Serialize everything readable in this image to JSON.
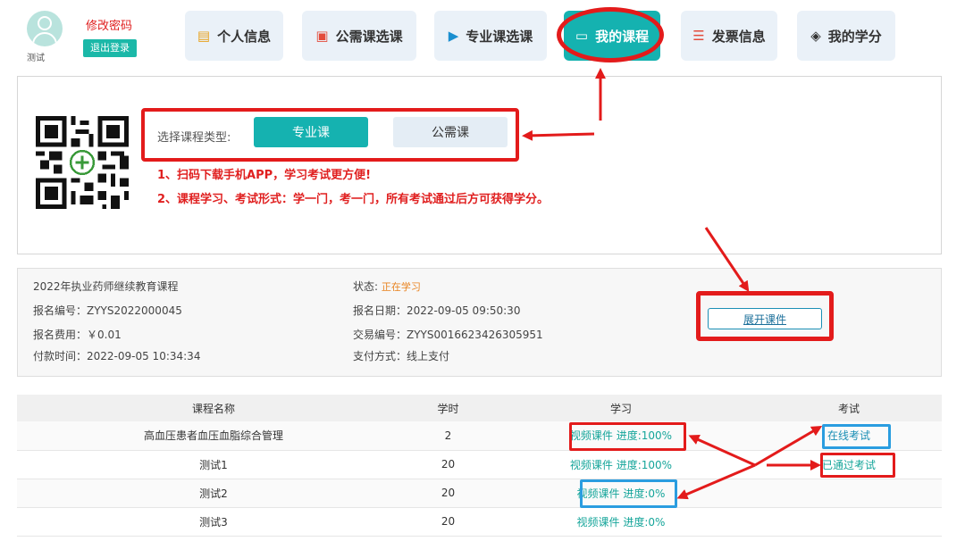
{
  "user": {
    "name": "测试",
    "change_password": "修改密码",
    "logout": "退出登录"
  },
  "nav": [
    {
      "label": "个人信息",
      "icon": "id-card-icon"
    },
    {
      "label": "公需课选课",
      "icon": "document-icon"
    },
    {
      "label": "专业课选课",
      "icon": "video-icon"
    },
    {
      "label": "我的课程",
      "icon": "chat-icon",
      "active": true
    },
    {
      "label": "发票信息",
      "icon": "invoice-icon"
    },
    {
      "label": "我的学分",
      "icon": "graduation-cap-icon"
    }
  ],
  "course_type": {
    "label": "选择课程类型:",
    "options": [
      "专业课",
      "公需课"
    ],
    "selected": "专业课"
  },
  "tips": [
    "1、扫码下载手机APP，学习考试更方便!",
    "2、课程学习、考试形式：学一门，考一门，所有考试通过后方可获得学分。"
  ],
  "enrollment": {
    "title": "2022年执业药师继续教育课程",
    "reg_no": "报名编号：ZYYS2022000045",
    "fee": "报名费用：￥0.01",
    "pay_time": "付款时间：2022-09-05 10:34:34",
    "status_label": "状态:",
    "status_value": "正在学习",
    "reg_date": "报名日期：2022-09-05 09:50:30",
    "trade_no": "交易编号：ZYYS0016623426305951",
    "pay_method": "支付方式：线上支付",
    "expand_button": "展开课件"
  },
  "table": {
    "headers": [
      "课程名称",
      "学时",
      "学习",
      "考试"
    ],
    "rows": [
      {
        "name": "高血压患者血压血脂综合管理",
        "hours": "2",
        "study": "视频课件 进度:100%",
        "exam": "在线考试"
      },
      {
        "name": "测试1",
        "hours": "20",
        "study": "视频课件 进度:100%",
        "exam": "已通过考试"
      },
      {
        "name": "测试2",
        "hours": "20",
        "study": "视频课件 进度:0%",
        "exam": ""
      },
      {
        "name": "测试3",
        "hours": "20",
        "study": "视频课件 进度:0%",
        "exam": ""
      }
    ]
  },
  "colors": {
    "accent": "#15b2b0",
    "annotation_red": "#e31b1b",
    "annotation_blue": "#2a9de0",
    "warning": "#e8821e"
  }
}
